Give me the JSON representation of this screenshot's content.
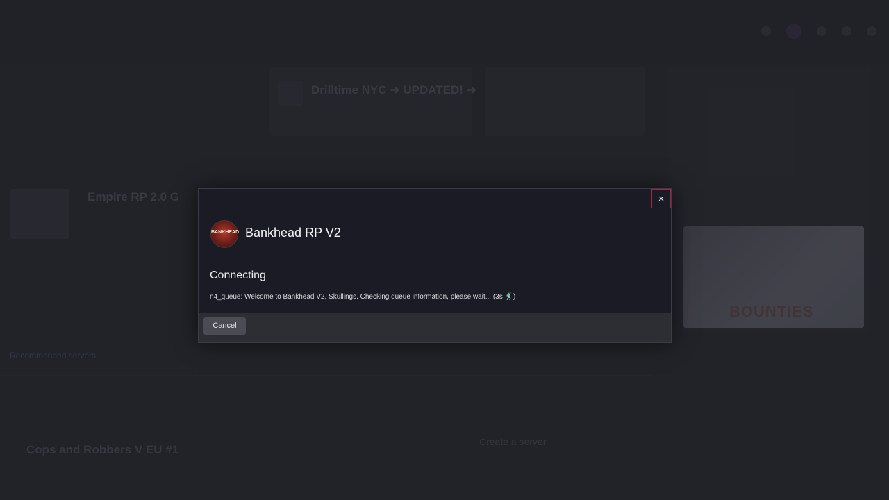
{
  "background": {
    "nav_items": [
      "",
      "",
      "",
      ""
    ],
    "featured_title": "Drilltime NYC ➜ UPDATED! ➜",
    "server_list_title": "Empire RP 2.0 G",
    "section_heading": "Recommended servers",
    "bottom_server_title": "Cops and Robbers V EU #1",
    "create_server_label": "Create a server",
    "promo_banner_text": "BOUNTIES"
  },
  "modal": {
    "close_symbol": "×",
    "server_name": "Bankhead RP V2",
    "logo_text": "BANKHEAD",
    "status_title": "Connecting",
    "status_message": "n4_queue: Welcome to Bankhead V2, Skullings. Checking queue information, please wait... (3s 🕺)",
    "cancel_label": "Cancel"
  },
  "colors": {
    "modal_bg": "#1a1b24",
    "footer_bg": "#2d2e34",
    "close_border": "#a3264a",
    "page_bg": "#2a2b31"
  }
}
